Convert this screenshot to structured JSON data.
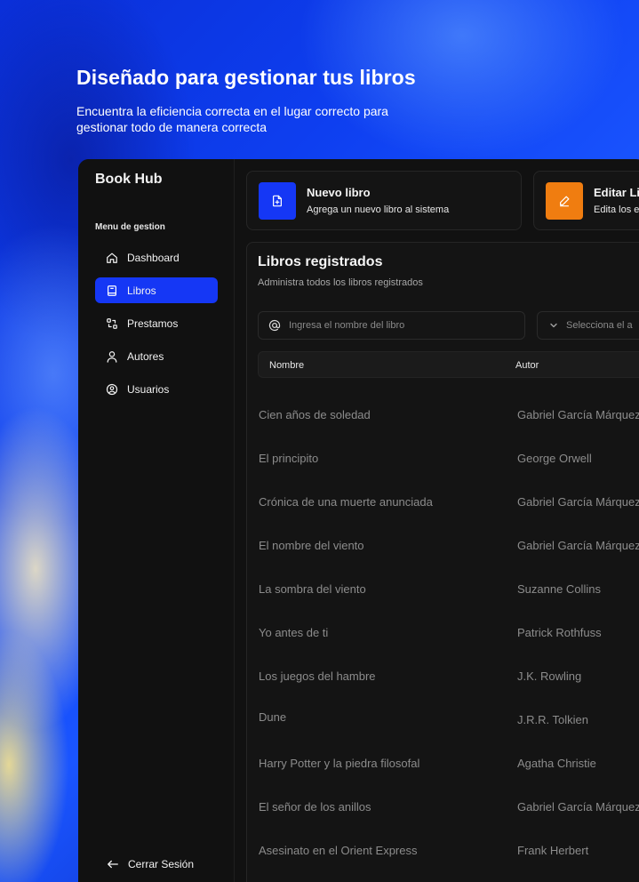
{
  "hero": {
    "title": "Diseñado para gestionar tus libros",
    "subtitle_line1": "Encuentra la eficiencia correcta en el lugar correcto para",
    "subtitle_line2": "gestionar todo de manera correcta"
  },
  "sidebar": {
    "brand": "Book Hub",
    "menu_title": "Menu de gestion",
    "items": [
      {
        "label": "Dashboard",
        "icon": "home-icon",
        "active": false
      },
      {
        "label": "Libros",
        "icon": "book-icon",
        "active": true
      },
      {
        "label": "Prestamos",
        "icon": "swap-icon",
        "active": false
      },
      {
        "label": "Autores",
        "icon": "user-icon",
        "active": false
      },
      {
        "label": "Usuarios",
        "icon": "user-circle-icon",
        "active": false
      }
    ],
    "logout_label": "Cerrar Sesión"
  },
  "cards": [
    {
      "title": "Nuevo libro",
      "description": "Agrega un nuevo libro al sistema",
      "icon": "file-plus-icon",
      "color": "#1537f5"
    },
    {
      "title": "Editar Li",
      "description": "Edita los e",
      "icon": "edit-icon",
      "color": "#f07d10"
    }
  ],
  "panel": {
    "title": "Libros registrados",
    "subtitle": "Administra todos los libros registrados",
    "search_placeholder": "Ingresa el nombre del libro",
    "select_placeholder": "Selecciona el a",
    "columns": {
      "name": "Nombre",
      "author": "Autor"
    },
    "rows": [
      {
        "name": "Cien años de soledad",
        "author": "Gabriel García Márquez"
      },
      {
        "name": "El principito",
        "author": "George Orwell"
      },
      {
        "name": "Crónica de una muerte anunciada",
        "author": "Gabriel García Márquez"
      },
      {
        "name": "El nombre del viento",
        "author": "Gabriel García Márquez"
      },
      {
        "name": "La sombra del viento",
        "author": "Suzanne Collins"
      },
      {
        "name": "Yo antes de ti",
        "author": "Patrick Rothfuss"
      },
      {
        "name": "Los juegos del hambre",
        "author": "J.K. Rowling"
      },
      {
        "name": "Dune",
        "author": "J.R.R. Tolkien"
      },
      {
        "name": "Harry Potter y la piedra filosofal",
        "author": "Agatha Christie"
      },
      {
        "name": "El señor de los anillos",
        "author": "Gabriel García Márquez"
      },
      {
        "name": "Asesinato en el Orient Express",
        "author": "Frank Herbert"
      }
    ]
  },
  "colors": {
    "accent": "#1537f5",
    "orange": "#f07d10",
    "surface": "#111111"
  }
}
